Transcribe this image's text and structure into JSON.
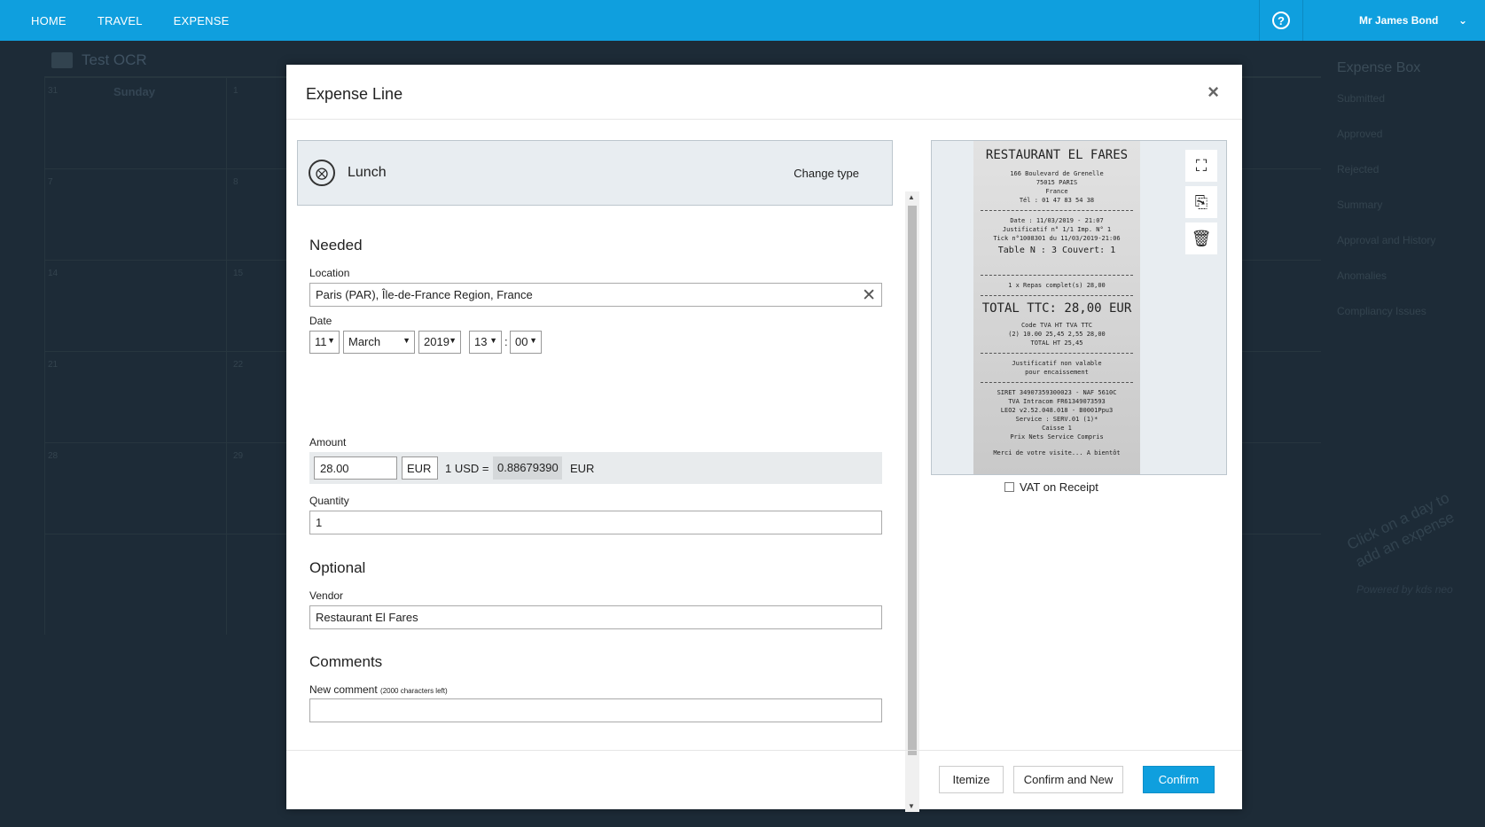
{
  "nav": {
    "items": [
      "HOME",
      "TRAVEL",
      "EXPENSE"
    ],
    "help_icon": "?",
    "user_name": "Mr James Bond",
    "user_chevron": "⌄"
  },
  "background": {
    "folder_title": "Test OCR",
    "sunday": "Sunday",
    "side_header": "Expense Box",
    "side_items": [
      "Submitted",
      "Approved",
      "Rejected"
    ],
    "side_sections": [
      "Summary",
      "Approval and History",
      "Anomalies",
      "Compliancy Issues"
    ],
    "hint": "Click on a day to add an expense",
    "powered": "Powered by kds neo",
    "day_numbers": [
      "31",
      "1",
      "7",
      "8",
      "14",
      "15",
      "21",
      "22",
      "28",
      "29"
    ]
  },
  "modal": {
    "title": "Expense Line",
    "close": "×",
    "type": {
      "label": "Lunch",
      "icon": "⨂",
      "change": "Change type"
    },
    "needed_title": "Needed",
    "location": {
      "label": "Location",
      "value": "Paris (PAR), Île-de-France Region, France",
      "clear": "✕"
    },
    "date": {
      "label": "Date",
      "day": "11",
      "month": "March",
      "year": "2019",
      "hour": "13",
      "separator": ":",
      "minute": "00",
      "arrow": "▼"
    },
    "amount": {
      "label": "Amount",
      "value": "28.00",
      "currency": "EUR",
      "rate_prefix": "1 USD =",
      "rate": "0.88679390",
      "rate_currency": "EUR"
    },
    "quantity": {
      "label": "Quantity",
      "value": "1"
    },
    "optional_title": "Optional",
    "vendor": {
      "label": "Vendor",
      "value": "Restaurant El Fares"
    },
    "comments_title": "Comments",
    "new_comment": {
      "label": "New comment",
      "hint": "(2000 characters left)",
      "value": ""
    },
    "receipt": {
      "title": "RESTAURANT EL FARES",
      "lines_top": [
        "166 Boulevard de Grenelle",
        "75015 PARIS",
        "France",
        "Tél : 01 47 83 54 38"
      ],
      "lines_mid": [
        "Date : 11/03/2019 - 21:07",
        "Justificatif n° 1/1 Imp. N° 1",
        "Tick n°1008301 du 11/03/2019-21:06"
      ],
      "table": "Table N : 3      Couvert: 1",
      "item": "1 x Repas complet(s)          28,00",
      "total": "TOTAL TTC:  28,00 EUR",
      "lines_vat": [
        "Code TVA    HT    TVA    TTC",
        "(2) 10.00  25,45  2,55  28,00",
        "TOTAL HT   25,45"
      ],
      "lines_bottom": [
        "Justificatif non valable",
        "pour encaissement"
      ],
      "lines_legal": [
        "SIRET 34907359300023 - NAF 5610C",
        "TVA Intracom FR61349073593",
        "LEO2 v2.52.048.018 - B0001Ppu3",
        "Service : SERV.01 (1)*",
        "Caisse 1",
        "Prix Nets Service Compris"
      ],
      "farewell": "Merci de votre visite...   A bientôt"
    },
    "tools": {
      "fullscreen": "⛶",
      "extract": "⎘",
      "delete": "🗑"
    },
    "vat_label": "VAT on Receipt",
    "buttons": {
      "itemize": "Itemize",
      "confirm_new": "Confirm and New",
      "confirm": "Confirm"
    },
    "scroll_up": "▲",
    "scroll_down": "▼"
  }
}
